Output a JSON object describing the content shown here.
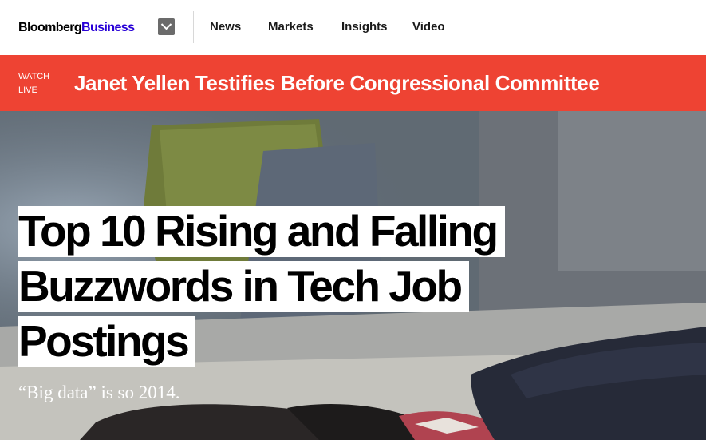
{
  "nav": {
    "brand_main": "Bloomberg",
    "brand_sub": "Business",
    "links": [
      "News",
      "Markets",
      "Insights",
      "Video"
    ]
  },
  "live": {
    "tag": "WATCH LIVE",
    "headline": "Janet Yellen Testifies Before Congressional Committee"
  },
  "article": {
    "headline": "Top 10 Rising and Falling Buzzwords in Tech Job Postings",
    "dek": "“Big data” is so 2014."
  },
  "colors": {
    "brand_accent": "#2800d7",
    "live_bar": "#ee4333"
  },
  "icons": [
    "chevron-down-icon"
  ]
}
